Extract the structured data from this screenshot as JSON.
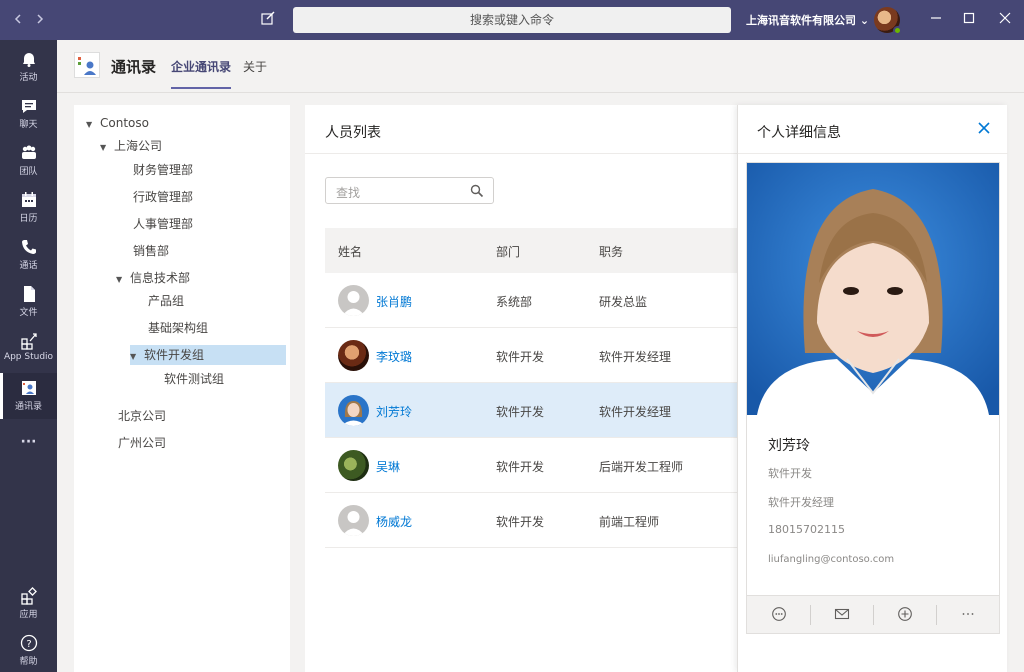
{
  "titlebar": {
    "command_placeholder": "搜索或键入命令",
    "org_name": "上海讯音软件有限公司 ⌄"
  },
  "rail": [
    {
      "label": "活动",
      "icon": "bell-icon"
    },
    {
      "label": "聊天",
      "icon": "chat-icon"
    },
    {
      "label": "团队",
      "icon": "teams-icon"
    },
    {
      "label": "日历",
      "icon": "calendar-icon"
    },
    {
      "label": "通话",
      "icon": "phone-icon"
    },
    {
      "label": "文件",
      "icon": "file-icon"
    },
    {
      "label": "App Studio",
      "icon": "app-studio-icon"
    },
    {
      "label": "通讯录",
      "icon": "contacts-icon"
    },
    {
      "label": "···",
      "icon": "more-icon"
    },
    {
      "label": "应用",
      "icon": "apps-icon"
    },
    {
      "label": "帮助",
      "icon": "help-icon"
    }
  ],
  "header": {
    "title": "通讯录",
    "tabs": [
      "企业通讯录",
      "关于"
    ]
  },
  "tree": {
    "root": "Contoso",
    "company1": "上海公司",
    "dept_finance": "财务管理部",
    "dept_admin": "行政管理部",
    "dept_hr": "人事管理部",
    "dept_sales": "销售部",
    "dept_it": "信息技术部",
    "group_product": "产品组",
    "group_infra": "基础架构组",
    "group_dev": "软件开发组",
    "group_test": "软件测试组",
    "company2": "北京公司",
    "company3": "广州公司"
  },
  "list": {
    "title": "人员列表",
    "search_placeholder": "查找",
    "columns": [
      "姓名",
      "部门",
      "职务"
    ],
    "rows": [
      {
        "name": "张肖鹏",
        "dept": "系统部",
        "title": "研发总监"
      },
      {
        "name": "李玟璐",
        "dept": "软件开发",
        "title": "软件开发经理"
      },
      {
        "name": "刘芳玲",
        "dept": "软件开发",
        "title": "软件开发经理"
      },
      {
        "name": "吴琳",
        "dept": "软件开发",
        "title": "后端开发工程师"
      },
      {
        "name": "杨威龙",
        "dept": "软件开发",
        "title": "前端工程师"
      }
    ]
  },
  "detail": {
    "title": "个人详细信息",
    "name": "刘芳玲",
    "dept": "软件开发",
    "job": "软件开发经理",
    "phone": "18015702115",
    "email": "liufangling@contoso.com"
  },
  "colors": {
    "titlebar": "#464775",
    "rail": "#33344a",
    "accent": "#6264a7",
    "link": "#0078d4",
    "selected_row": "#deecf9",
    "selected_tree": "#c7e0f4"
  }
}
